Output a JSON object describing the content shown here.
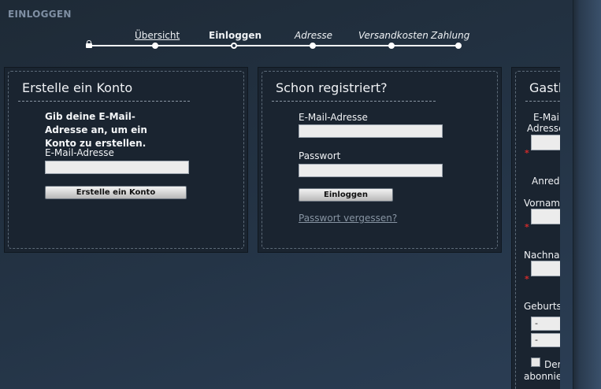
{
  "page": {
    "title": "EINLOGGEN"
  },
  "steps": [
    {
      "label": "Übersicht",
      "state": "link"
    },
    {
      "label": "Einloggen",
      "state": "current"
    },
    {
      "label": "Adresse",
      "state": "upcoming"
    },
    {
      "label": "Versandkosten",
      "state": "upcoming"
    },
    {
      "label": "Zahlung",
      "state": "upcoming"
    }
  ],
  "create_account": {
    "title": "Erstelle ein Konto",
    "intro": "Gib deine E-Mail-Adresse an, um ein Konto zu erstellen.",
    "email_label": "E-Mail-Adresse",
    "email_value": "",
    "button_label": "Erstelle ein Konto"
  },
  "login": {
    "title": "Schon registriert?",
    "email_label": "E-Mail-Adresse",
    "email_value": "",
    "password_label": "Passwort",
    "password_value": "",
    "button_label": "Einloggen",
    "forgot_link": "Passwort vergessen?"
  },
  "guest": {
    "title": "Gastb",
    "email_label_1": "E-Mail",
    "email_label_2": "Adresse",
    "salutation_label": "Anred",
    "firstname_label": "Vorname",
    "lastname_label": "Nachnam",
    "birthdate_label": "Geburts",
    "select_day": "-",
    "select_month": "-",
    "newsletter_label_1": "Der",
    "newsletter_label_2": "abonnie",
    "required_marker": "*"
  },
  "colors": {
    "background": "#243446",
    "panel": "#1a2430",
    "required": "#d02a2a"
  }
}
